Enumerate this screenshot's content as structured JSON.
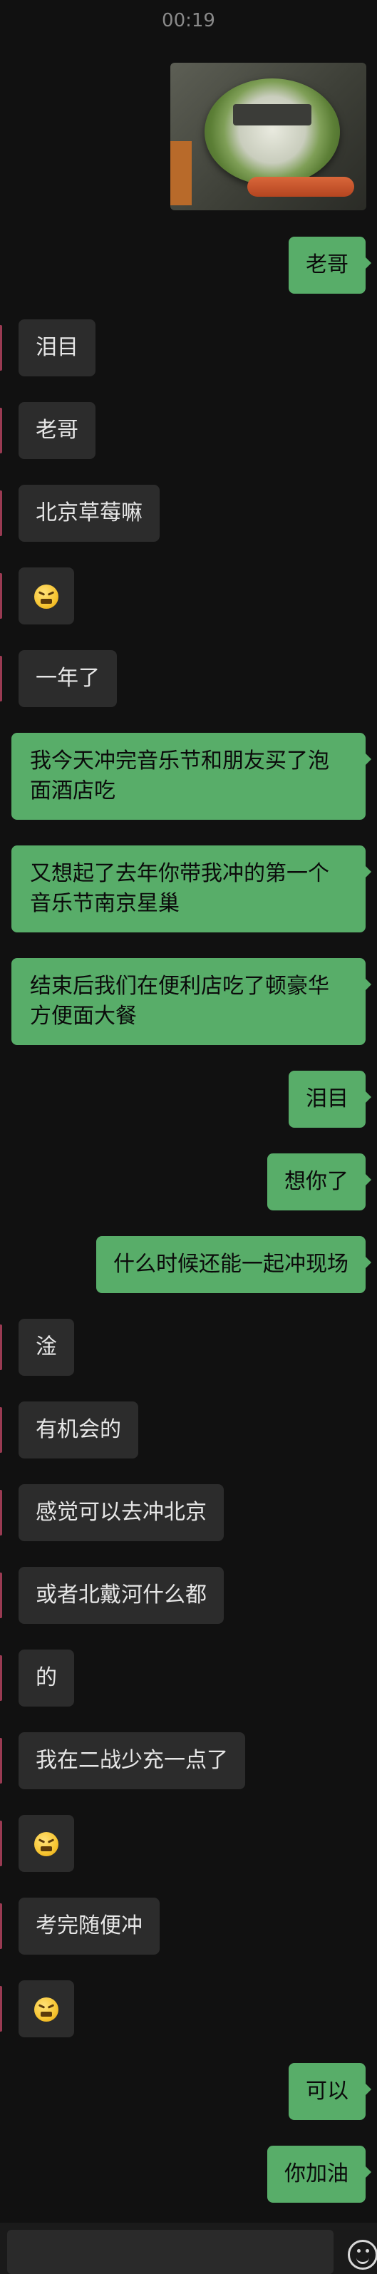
{
  "status": {
    "time": "00:19"
  },
  "messages": [
    {
      "side": "out",
      "type": "image",
      "icon": "instant-noodle-photo"
    },
    {
      "side": "out",
      "text": "老哥"
    },
    {
      "side": "in",
      "text": "泪目"
    },
    {
      "side": "in",
      "text": "老哥"
    },
    {
      "side": "in",
      "text": "北京草莓嘛"
    },
    {
      "side": "in",
      "type": "emoji",
      "icon": "grimace-emoji"
    },
    {
      "side": "in",
      "text": "一年了"
    },
    {
      "side": "out",
      "text": "我今天冲完音乐节和朋友买了泡面酒店吃"
    },
    {
      "side": "out",
      "text": "又想起了去年你带我冲的第一个音乐节南京星巢"
    },
    {
      "side": "out",
      "text": "结束后我们在便利店吃了顿豪华方便面大餐"
    },
    {
      "side": "out",
      "text": "泪目"
    },
    {
      "side": "out",
      "text": "想你了"
    },
    {
      "side": "out",
      "text": "什么时候还能一起冲现场"
    },
    {
      "side": "in",
      "text": "淦"
    },
    {
      "side": "in",
      "text": "有机会的"
    },
    {
      "side": "in",
      "text": "感觉可以去冲北京"
    },
    {
      "side": "in",
      "text": "或者北戴河什么都"
    },
    {
      "side": "in",
      "text": "的"
    },
    {
      "side": "in",
      "text": "我在二战少充一点了"
    },
    {
      "side": "in",
      "type": "emoji",
      "icon": "grimace-emoji"
    },
    {
      "side": "in",
      "text": "考完随便冲"
    },
    {
      "side": "in",
      "type": "emoji",
      "icon": "grimace-emoji"
    },
    {
      "side": "out",
      "text": "可以"
    },
    {
      "side": "out",
      "text": "你加油"
    }
  ],
  "composer": {
    "input_value": "",
    "emoji_icon": "smiley-face-icon"
  },
  "colors": {
    "background": "#111111",
    "outgoing_bubble": "#58ad69",
    "incoming_bubble": "#2c2c2c"
  }
}
